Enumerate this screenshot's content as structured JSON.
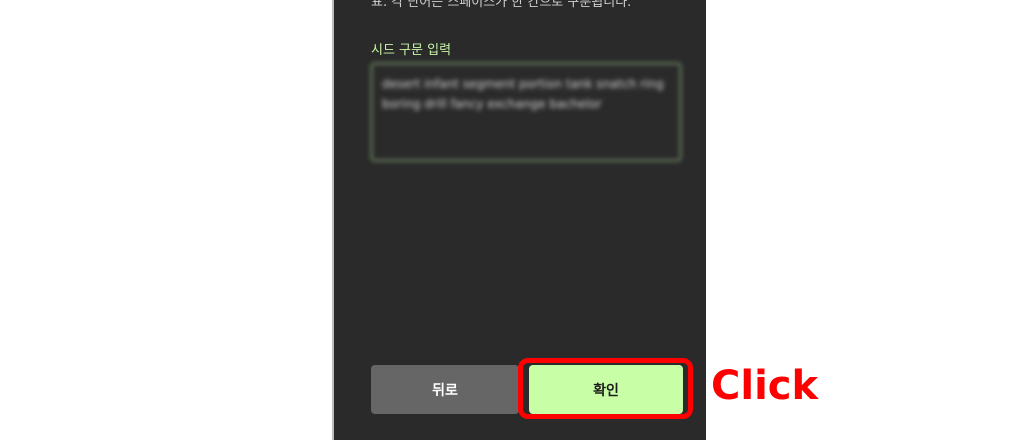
{
  "panel": {
    "cutoff_text": "표. 각 단어는 스페이스가 한 칸으로 구분됩니다.",
    "seed_label": "시드 구문 입력",
    "seed_value": "desert infant segment portion tank snatch ring boring drill fancy exchange bachelor"
  },
  "buttons": {
    "back_label": "뒤로",
    "confirm_label": "확인"
  },
  "annotation": {
    "click_text": "Click",
    "highlight_color": "#ff0000"
  },
  "colors": {
    "panel_bg": "#2a2a2a",
    "accent_green": "#c8ffa6",
    "back_button_bg": "#666666"
  }
}
